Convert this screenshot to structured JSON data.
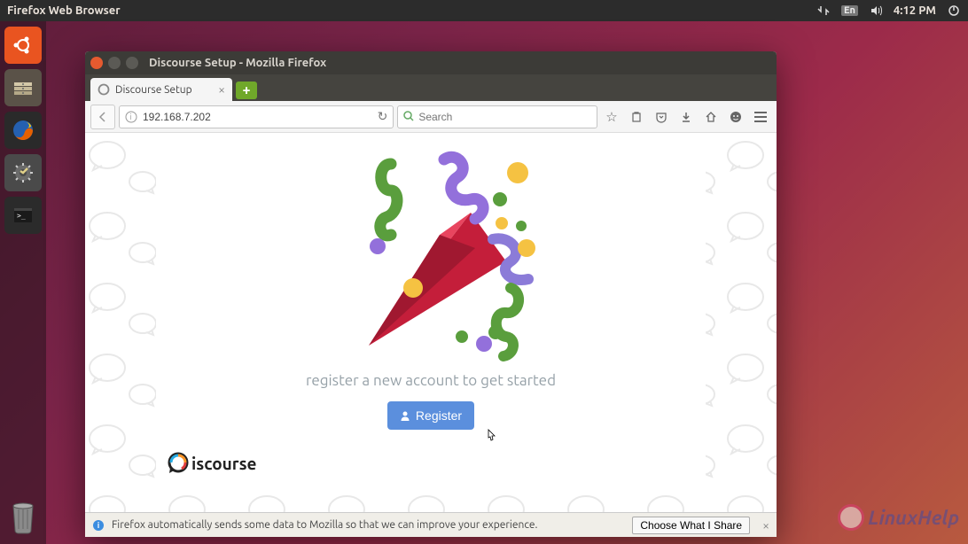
{
  "system": {
    "app_title": "Firefox Web Browser",
    "lang": "En",
    "time": "4:12 PM"
  },
  "launcher": {
    "items": [
      "ubuntu-dash",
      "files",
      "firefox",
      "settings",
      "terminal"
    ]
  },
  "window": {
    "title": "Discourse Setup - Mozilla Firefox",
    "tab": {
      "label": "Discourse Setup"
    },
    "url": "192.168.7.202",
    "search_placeholder": "Search"
  },
  "page": {
    "subtitle": "register a new account to get started",
    "register_label": "Register",
    "brand": "iscourse"
  },
  "infobar": {
    "message": "Firefox automatically sends some data to Mozilla so that we can improve your experience.",
    "button": "Choose What I Share"
  },
  "watermark": "LinuxHelp"
}
